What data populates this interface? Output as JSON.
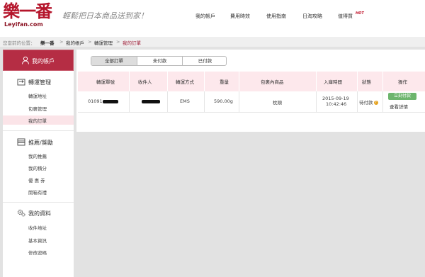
{
  "header": {
    "logo_text": "樂一番",
    "logo_url": "Leyifan.com",
    "slogan": "輕鬆把日本商品送到家！",
    "nav": [
      "我的帳戶",
      "費用時效",
      "使用指南",
      "日淘攻略",
      "值得買"
    ],
    "hot_badge": "HOT"
  },
  "breadcrumb": {
    "prefix": "您當前的位置：",
    "items": [
      "樂一番",
      "我的帳戶",
      "轉運管理",
      "我的訂單"
    ],
    "separator": ">"
  },
  "sidebar": {
    "account_title": "我的帳戶",
    "sections": [
      {
        "title": "轉運管理",
        "icon": "forward-icon",
        "items": [
          "轉運地址",
          "包裹管理",
          "我的訂單"
        ],
        "active_index": 2
      },
      {
        "title": "推薦/獎勵",
        "icon": "gift-icon",
        "items": [
          "我的推薦",
          "我的積分",
          "優 惠 券",
          "開箱有禮"
        ]
      },
      {
        "title": "我的資料",
        "icon": "gears-icon",
        "items": [
          "收件地址",
          "基本資訊",
          "修改密碼"
        ]
      }
    ]
  },
  "tabs": {
    "items": [
      "全部訂單",
      "未付款",
      "已付款"
    ],
    "active": 0
  },
  "table": {
    "headers": [
      "轉運單號",
      "收件人",
      "轉運方式",
      "重量",
      "包裹內商品",
      "入庫時間",
      "狀態",
      "操作"
    ],
    "rows": [
      {
        "order_no_prefix": "01091",
        "shipping": "EMS",
        "weight": "590.00g",
        "contents": "枕頭",
        "date": "2015-09-19",
        "time": "10:42:46",
        "status": "待付款",
        "pay_button": "立刻付款",
        "detail_link": "查看詳情"
      }
    ]
  },
  "colors": {
    "brand": "#b5152b",
    "accent_header": "#b52d44",
    "table_header_bg": "#fde8ec",
    "pay_button": "#6db56d"
  }
}
